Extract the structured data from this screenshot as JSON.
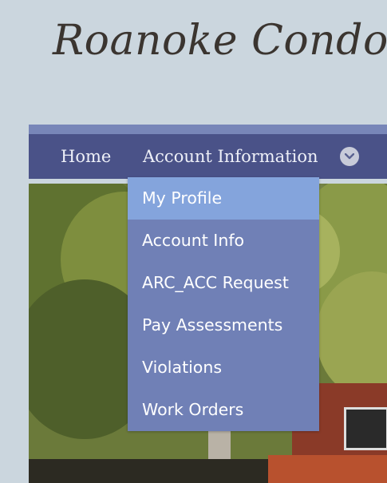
{
  "site": {
    "title": "Roanoke Condominiums"
  },
  "nav": {
    "home_label": "Home",
    "account_label": "Account Information",
    "more_icon": "chevron-down-icon"
  },
  "dropdown": {
    "items": [
      {
        "label": "My Profile",
        "active": true
      },
      {
        "label": "Account Info",
        "active": false
      },
      {
        "label": "ARC_ACC Request",
        "active": false
      },
      {
        "label": "Pay Assessments",
        "active": false
      },
      {
        "label": "Violations",
        "active": false
      },
      {
        "label": "Work Orders",
        "active": false
      }
    ]
  },
  "colors": {
    "background": "#cbd6de",
    "navbar": "#4a5288",
    "nav_strip": "#7886b8",
    "dropdown": "#7080b6",
    "dropdown_active": "#84a4dc",
    "title_text": "#3b3530"
  }
}
